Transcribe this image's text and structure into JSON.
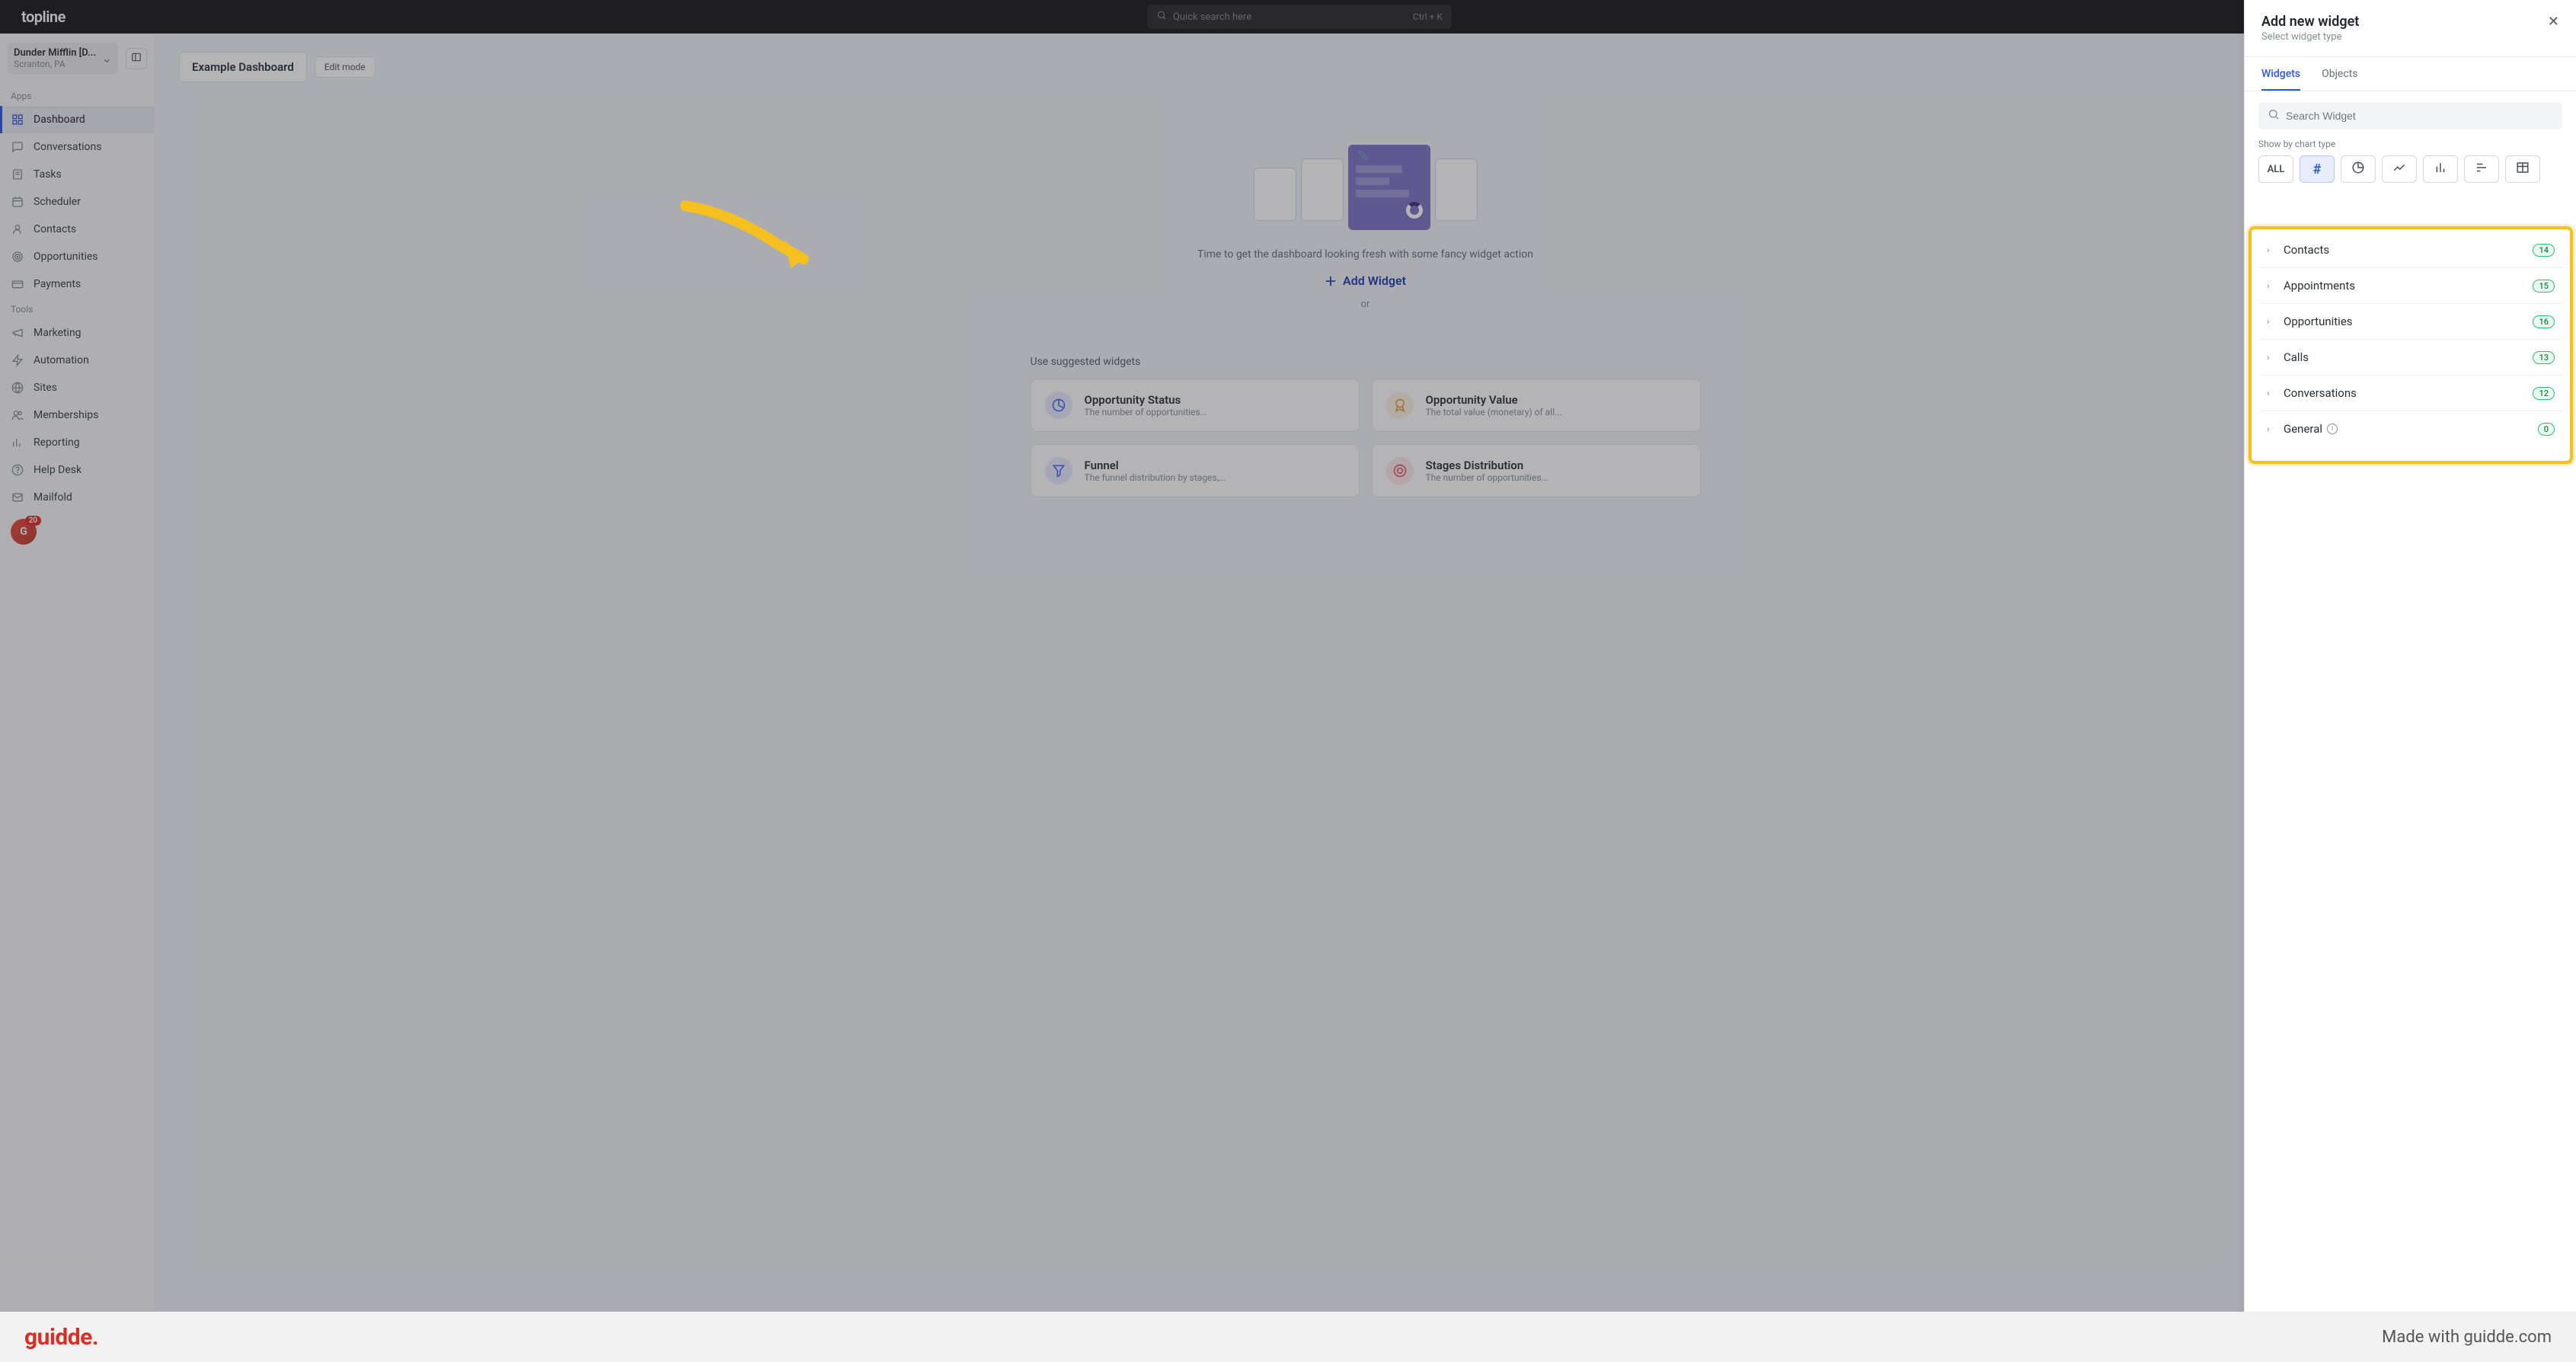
{
  "header": {
    "logo": "topline",
    "search_placeholder": "Quick search here",
    "search_kbd": "Ctrl + K"
  },
  "tenant": {
    "name": "Dunder Mifflin [D...",
    "location": "Scranton, PA"
  },
  "sidebar": {
    "section_apps": "Apps",
    "section_tools": "Tools",
    "apps": [
      {
        "label": "Dashboard"
      },
      {
        "label": "Conversations"
      },
      {
        "label": "Tasks"
      },
      {
        "label": "Scheduler"
      },
      {
        "label": "Contacts"
      },
      {
        "label": "Opportunities"
      },
      {
        "label": "Payments"
      }
    ],
    "tools": [
      {
        "label": "Marketing"
      },
      {
        "label": "Automation"
      },
      {
        "label": "Sites"
      },
      {
        "label": "Memberships"
      },
      {
        "label": "Reporting"
      },
      {
        "label": "Help Desk"
      },
      {
        "label": "Mailfold"
      }
    ],
    "avatar_initial": "G",
    "notif_count": "20"
  },
  "dashboard": {
    "title": "Example Dashboard",
    "edit_mode": "Edit mode",
    "empty_text": "Time to get the dashboard looking fresh with some fancy widget action",
    "add_widget": "Add Widget",
    "or": "or",
    "suggested_label": "Use suggested widgets",
    "suggested": [
      {
        "title": "Opportunity Status",
        "desc": "The number of opportunities...",
        "iconColor": "#4f6cf0",
        "iconBg": "#e8ecff"
      },
      {
        "title": "Opportunity Value",
        "desc": "The total value (monetary) of all...",
        "iconColor": "#e6a23c",
        "iconBg": "#fdf3e3"
      },
      {
        "title": "Funnel",
        "desc": "The funnel distribution by stages,...",
        "iconColor": "#4f6cf0",
        "iconBg": "#e8ecff"
      },
      {
        "title": "Stages Distribution",
        "desc": "The number of opportunities...",
        "iconColor": "#e05a6a",
        "iconBg": "#fde8ea"
      }
    ]
  },
  "panel": {
    "title": "Add new widget",
    "subtitle": "Select widget type",
    "tabs": [
      {
        "label": "Widgets",
        "active": true
      },
      {
        "label": "Objects",
        "active": false
      }
    ],
    "search_placeholder": "Search Widget",
    "chart_type_label": "Show by chart type",
    "chart_all": "ALL",
    "categories": [
      {
        "name": "Contacts",
        "count": "14"
      },
      {
        "name": "Appointments",
        "count": "15"
      },
      {
        "name": "Opportunities",
        "count": "16"
      },
      {
        "name": "Calls",
        "count": "13"
      },
      {
        "name": "Conversations",
        "count": "12"
      },
      {
        "name": "General",
        "count": "0",
        "info": true
      }
    ]
  },
  "footer": {
    "logo": "guidde.",
    "made_with": "Made with guidde.com"
  }
}
